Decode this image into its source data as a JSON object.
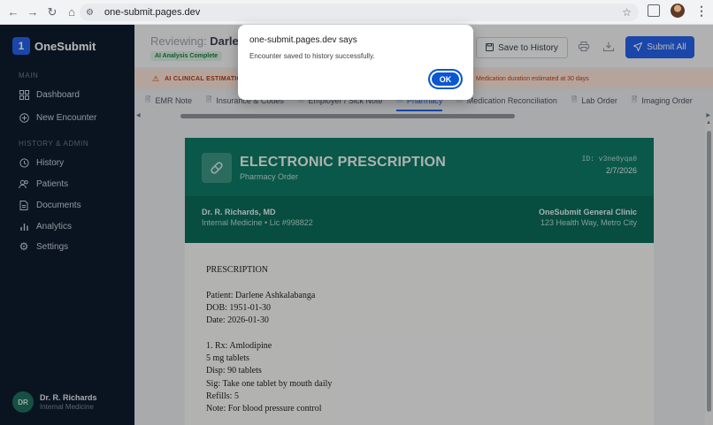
{
  "browser": {
    "url": "one-submit.pages.dev",
    "nav_icons": [
      "back-icon",
      "forward-icon",
      "reload-icon",
      "home-icon"
    ]
  },
  "sidebar": {
    "logo_mark": "1",
    "brand": "OneSubmit",
    "section_main": "MAIN",
    "main_items": [
      {
        "label": "Dashboard",
        "icon": "grid-icon"
      },
      {
        "label": "New Encounter",
        "icon": "plus-circle-icon"
      }
    ],
    "section_history": "HISTORY & ADMIN",
    "admin_items": [
      {
        "label": "History",
        "icon": "history-icon"
      },
      {
        "label": "Patients",
        "icon": "users-icon"
      },
      {
        "label": "Documents",
        "icon": "document-icon"
      },
      {
        "label": "Analytics",
        "icon": "bar-chart-icon"
      },
      {
        "label": "Settings",
        "icon": "gear-icon"
      }
    ],
    "user": {
      "initials": "DR",
      "name": "Dr. R. Richards",
      "role": "Internal Medicine"
    }
  },
  "header": {
    "reviewing_label": "Reviewing:",
    "patient_partial": "Darlen",
    "ai_badge": "AI Analysis Complete",
    "save_label": "Save to History",
    "submit_label": "Submit All"
  },
  "alert": {
    "title": "AI CLINICAL ESTIMATIO",
    "message": "Medication duration estimated at 30 days"
  },
  "tabs": [
    {
      "label": "EMR Note",
      "active": false
    },
    {
      "label": "Insurance & Codes",
      "active": false
    },
    {
      "label": "Employer / Sick Note",
      "active": false
    },
    {
      "label": "Pharmacy",
      "active": true
    },
    {
      "label": "Medication Reconciliation",
      "active": false
    },
    {
      "label": "Lab Order",
      "active": false
    },
    {
      "label": "Imaging Order",
      "active": false
    }
  ],
  "prescription": {
    "title": "ELECTRONIC PRESCRIPTION",
    "subtitle": "Pharmacy Order",
    "id_text": "ID: v3ne0yqa0",
    "date": "2/7/2026",
    "doctor_name": "Dr. R. Richards, MD",
    "doctor_specialty": "Internal Medicine • Lic #998822",
    "clinic_name": "OneSubmit General Clinic",
    "clinic_address": "123 Health Way, Metro City",
    "body_lines": [
      "PRESCRIPTION",
      "",
      "Patient: Darlene Ashkalabanga",
      "DOB: 1951-01-30",
      "Date: 2026-01-30",
      "",
      "1. Rx: Amlodipine",
      "5 mg tablets",
      "Disp: 90 tablets",
      "Sig: Take one tablet by mouth daily",
      "Refills: 5",
      "Note: For blood pressure control"
    ]
  },
  "dialog": {
    "title": "one-submit.pages.dev says",
    "message": "Encounter saved to history successfully.",
    "ok_label": "OK"
  },
  "colors": {
    "accent": "#2563eb",
    "sidebar_bg": "#0f1d2e",
    "rx_header": "#0f7a66",
    "alert_bg": "#fbe3d9"
  }
}
